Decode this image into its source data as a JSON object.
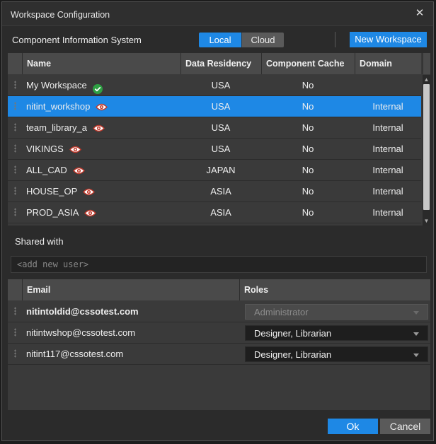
{
  "window": {
    "title": "Workspace Configuration",
    "close_glyph": "✕"
  },
  "toolbar": {
    "label": "Component Information System",
    "local_label": "Local",
    "cloud_label": "Cloud",
    "new_workspace_label": "New Workspace"
  },
  "workspace_table": {
    "columns": [
      "Name",
      "Data Residency",
      "Component Cache",
      "Domain"
    ],
    "rows": [
      {
        "name": "My Workspace",
        "icon": "check-icon",
        "residency": "USA",
        "cache": "No",
        "domain": ""
      },
      {
        "name": "nitint_workshop",
        "icon": "eye-icon",
        "residency": "USA",
        "cache": "No",
        "domain": "Internal",
        "selected": true
      },
      {
        "name": "team_library_a",
        "icon": "eye-icon",
        "residency": "USA",
        "cache": "No",
        "domain": "Internal"
      },
      {
        "name": "VIKINGS",
        "icon": "eye-icon",
        "residency": "USA",
        "cache": "No",
        "domain": "Internal"
      },
      {
        "name": "ALL_CAD",
        "icon": "eye-icon",
        "residency": "JAPAN",
        "cache": "No",
        "domain": "Internal"
      },
      {
        "name": "HOUSE_OP",
        "icon": "eye-icon",
        "residency": "ASIA",
        "cache": "No",
        "domain": "Internal"
      },
      {
        "name": "PROD_ASIA",
        "icon": "eye-icon",
        "residency": "ASIA",
        "cache": "No",
        "domain": "Internal"
      }
    ]
  },
  "shared": {
    "label": "Shared with",
    "add_user_placeholder": "<add new user>"
  },
  "users_table": {
    "columns": [
      "Email",
      "Roles"
    ],
    "rows": [
      {
        "email": "nitintoldid@cssotest.com",
        "role": "Administrator",
        "disabled": true,
        "bold": true
      },
      {
        "email": "nitintwshop@cssotest.com",
        "role": "Designer, Librarian",
        "disabled": false
      },
      {
        "email": "nitint117@cssotest.com",
        "role": "Designer, Librarian",
        "disabled": false
      }
    ]
  },
  "footer": {
    "ok_label": "Ok",
    "cancel_label": "Cancel"
  },
  "colors": {
    "accent": "#1e88e5",
    "eye_red": "#c0392b",
    "check_green": "#2ea043"
  }
}
